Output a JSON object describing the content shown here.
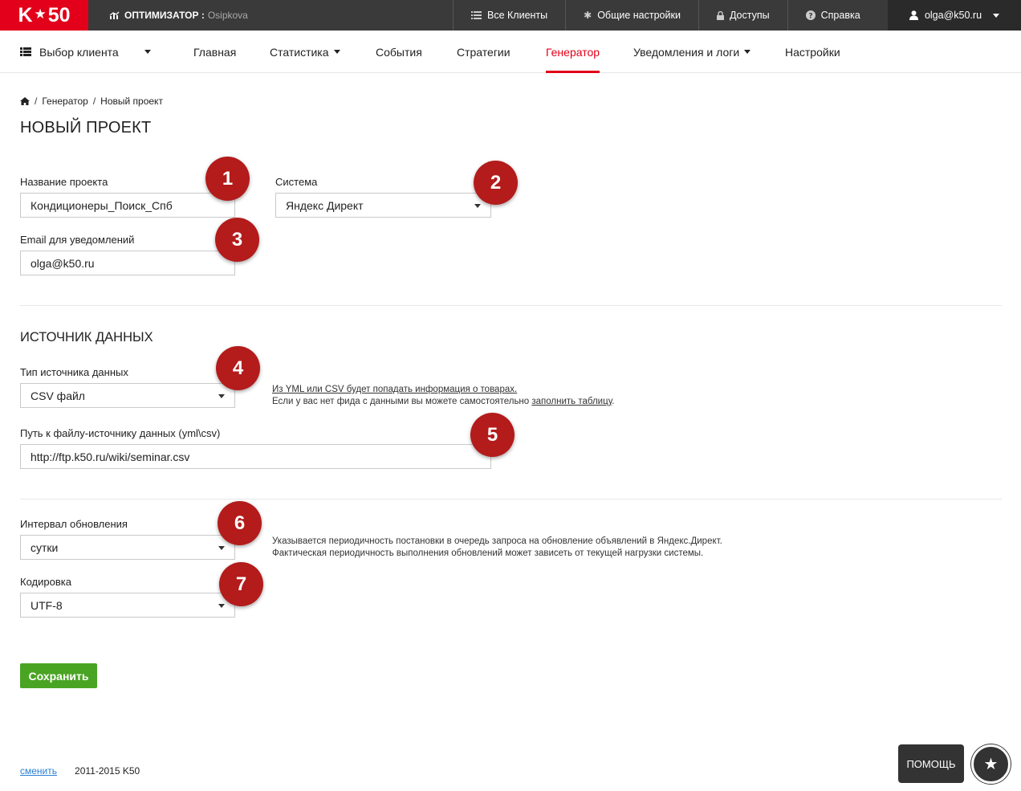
{
  "topbar": {
    "logo_left": "K",
    "logo_star": "★",
    "logo_right": "50",
    "optimizer_label": "ОПТИМИЗАТОР :",
    "optimizer_value": "Osipkova",
    "nav": [
      {
        "label": "Все Клиенты",
        "icon": "list-icon"
      },
      {
        "label": "Общие настройки",
        "icon": "gear-icon"
      },
      {
        "label": "Доступы",
        "icon": "lock-icon"
      },
      {
        "label": "Справка",
        "icon": "question-icon"
      }
    ],
    "user_email": "olga@k50.ru"
  },
  "secnav": {
    "client_select": "Выбор клиента",
    "items": [
      "Главная",
      "Статистика",
      "События",
      "Стратегии",
      "Генератор",
      "Уведомления и логи",
      "Настройки"
    ],
    "active": "Генератор"
  },
  "breadcrumb": {
    "home_icon": "home-icon",
    "items": [
      "Генератор",
      "Новый проект"
    ],
    "sep": "/"
  },
  "page_title": "НОВЫЙ ПРОЕКТ",
  "form": {
    "project_name": {
      "label": "Название проекта",
      "value": "Кондиционеры_Поиск_Спб"
    },
    "system": {
      "label": "Система",
      "value": "Яндекс Директ"
    },
    "email": {
      "label": "Email для уведомлений",
      "value": "olga@k50.ru"
    }
  },
  "data_source": {
    "title": "ИСТОЧНИК ДАННЫХ",
    "type": {
      "label": "Тип источника данных",
      "value": "CSV файл"
    },
    "help_line1": "Из YML или CSV будет попадать информация о товарах.",
    "help_line2_prefix": "Если у вас нет фида с данными вы можете самостоятельно ",
    "help_line2_link": "заполнить таблицу",
    "help_line2_suffix": ".",
    "path": {
      "label": "Путь к файлу-источнику данных (yml\\csv)",
      "value": "http://ftp.k50.ru/wiki/seminar.csv"
    }
  },
  "update": {
    "interval": {
      "label": "Интервал обновления",
      "value": "сутки"
    },
    "help_line1": "Указывается периодичность постановки в очередь запроса на обновление объявлений в Яндекс.Директ.",
    "help_line2": "Фактическая периодичность выполнения обновлений может зависеть от текущей нагрузки системы.",
    "encoding": {
      "label": "Кодировка",
      "value": "UTF-8"
    }
  },
  "badges": [
    "1",
    "2",
    "3",
    "4",
    "5",
    "6",
    "7"
  ],
  "save_label": "Сохранить",
  "footer": {
    "switch_label": "сменить",
    "copyright": "2011-2015 K50"
  },
  "help_widget": {
    "label": "ПОМОЩЬ",
    "icon": "star-icon"
  },
  "colors": {
    "brand": "#e2001a",
    "topbar": "#3a3a3a",
    "save": "#4aa423",
    "badge": "#b41b1b"
  }
}
